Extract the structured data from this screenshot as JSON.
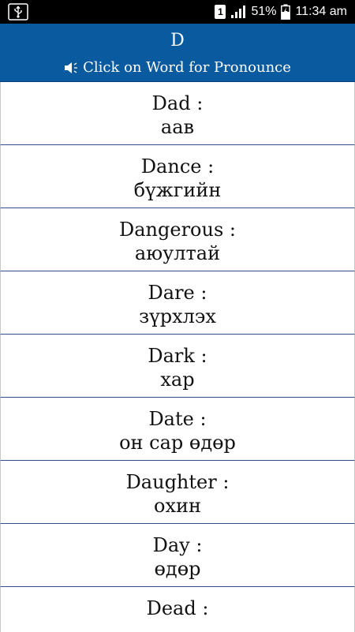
{
  "status_bar": {
    "sim": "1",
    "battery": "51%",
    "time": "11:34 am"
  },
  "header": {
    "title": "D",
    "subtitle": "Click on Word for Pronounce"
  },
  "words": [
    {
      "en": "Dad :",
      "mn": "аав"
    },
    {
      "en": "Dance :",
      "mn": "бүжгийн"
    },
    {
      "en": "Dangerous :",
      "mn": "аюултай"
    },
    {
      "en": "Dare :",
      "mn": "зүрхлэх"
    },
    {
      "en": "Dark :",
      "mn": "хар"
    },
    {
      "en": "Date :",
      "mn": "он сар өдөр"
    },
    {
      "en": "Daughter :",
      "mn": "охин"
    },
    {
      "en": "Day :",
      "mn": "өдөр"
    },
    {
      "en": "Dead :",
      "mn": ""
    }
  ],
  "colors": {
    "header_bg": "#0a5aa0",
    "divider": "#2d4f86"
  }
}
